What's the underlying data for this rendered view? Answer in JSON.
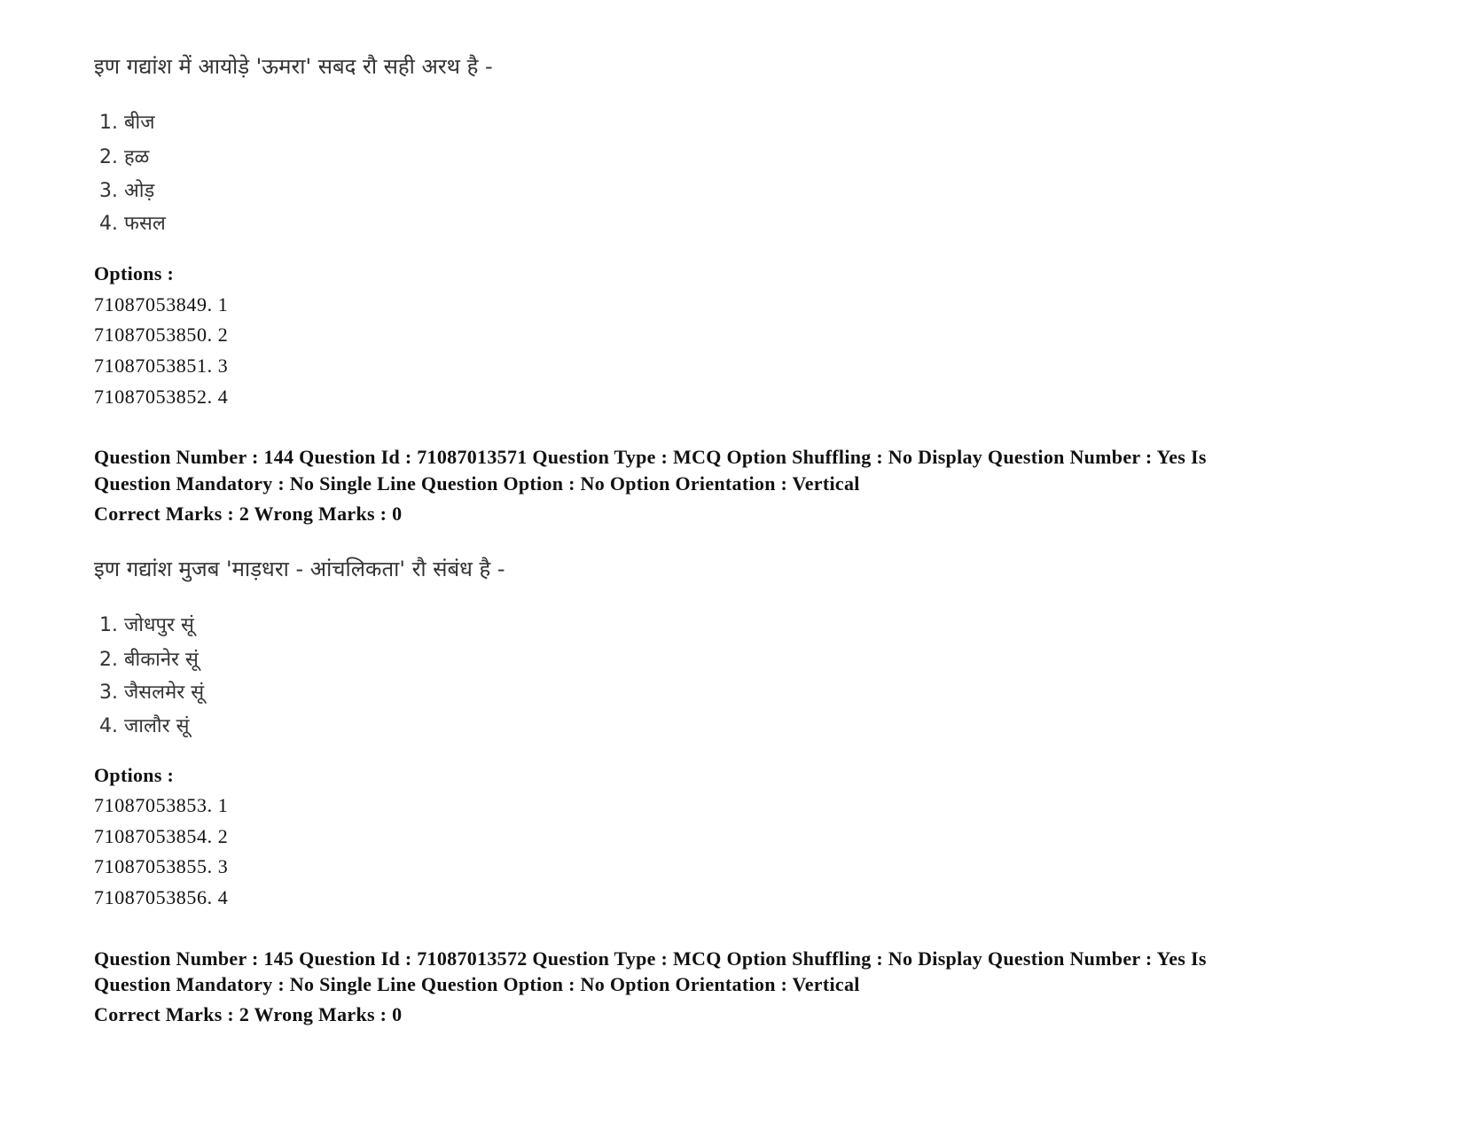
{
  "questions": [
    {
      "text": "इण गद्यांश में आयोड़े 'ऊमरा' सबद रौ सही अरथ है -",
      "choices": [
        "1. बीज",
        "2. हळ",
        "3. ओड़",
        "4. फसल"
      ],
      "options_label": "Options :",
      "options": [
        "71087053849. 1",
        "71087053850. 2",
        "71087053851. 3",
        "71087053852. 4"
      ]
    },
    {
      "header_line1": "Question Number : 144 Question Id : 71087013571 Question Type : MCQ Option Shuffling : No Display Question Number : Yes Is",
      "header_line2": "Question Mandatory : No Single Line Question Option : No Option Orientation : Vertical",
      "marks": "Correct Marks : 2 Wrong Marks : 0",
      "text": "इण गद्यांश मुजब 'माड़धरा - आंचलिकता' रौ संबंध है -",
      "choices": [
        "1. जोधपुर सूं",
        "2. बीकानेर सूं",
        "3. जैसलमेर सूं",
        "4. जालौर सूं"
      ],
      "options_label": "Options :",
      "options": [
        "71087053853. 1",
        "71087053854. 2",
        "71087053855. 3",
        "71087053856. 4"
      ]
    },
    {
      "header_line1": "Question Number : 145 Question Id : 71087013572 Question Type : MCQ Option Shuffling : No Display Question Number : Yes Is",
      "header_line2": "Question Mandatory : No Single Line Question Option : No Option Orientation : Vertical",
      "marks": "Correct Marks : 2 Wrong Marks : 0"
    }
  ]
}
